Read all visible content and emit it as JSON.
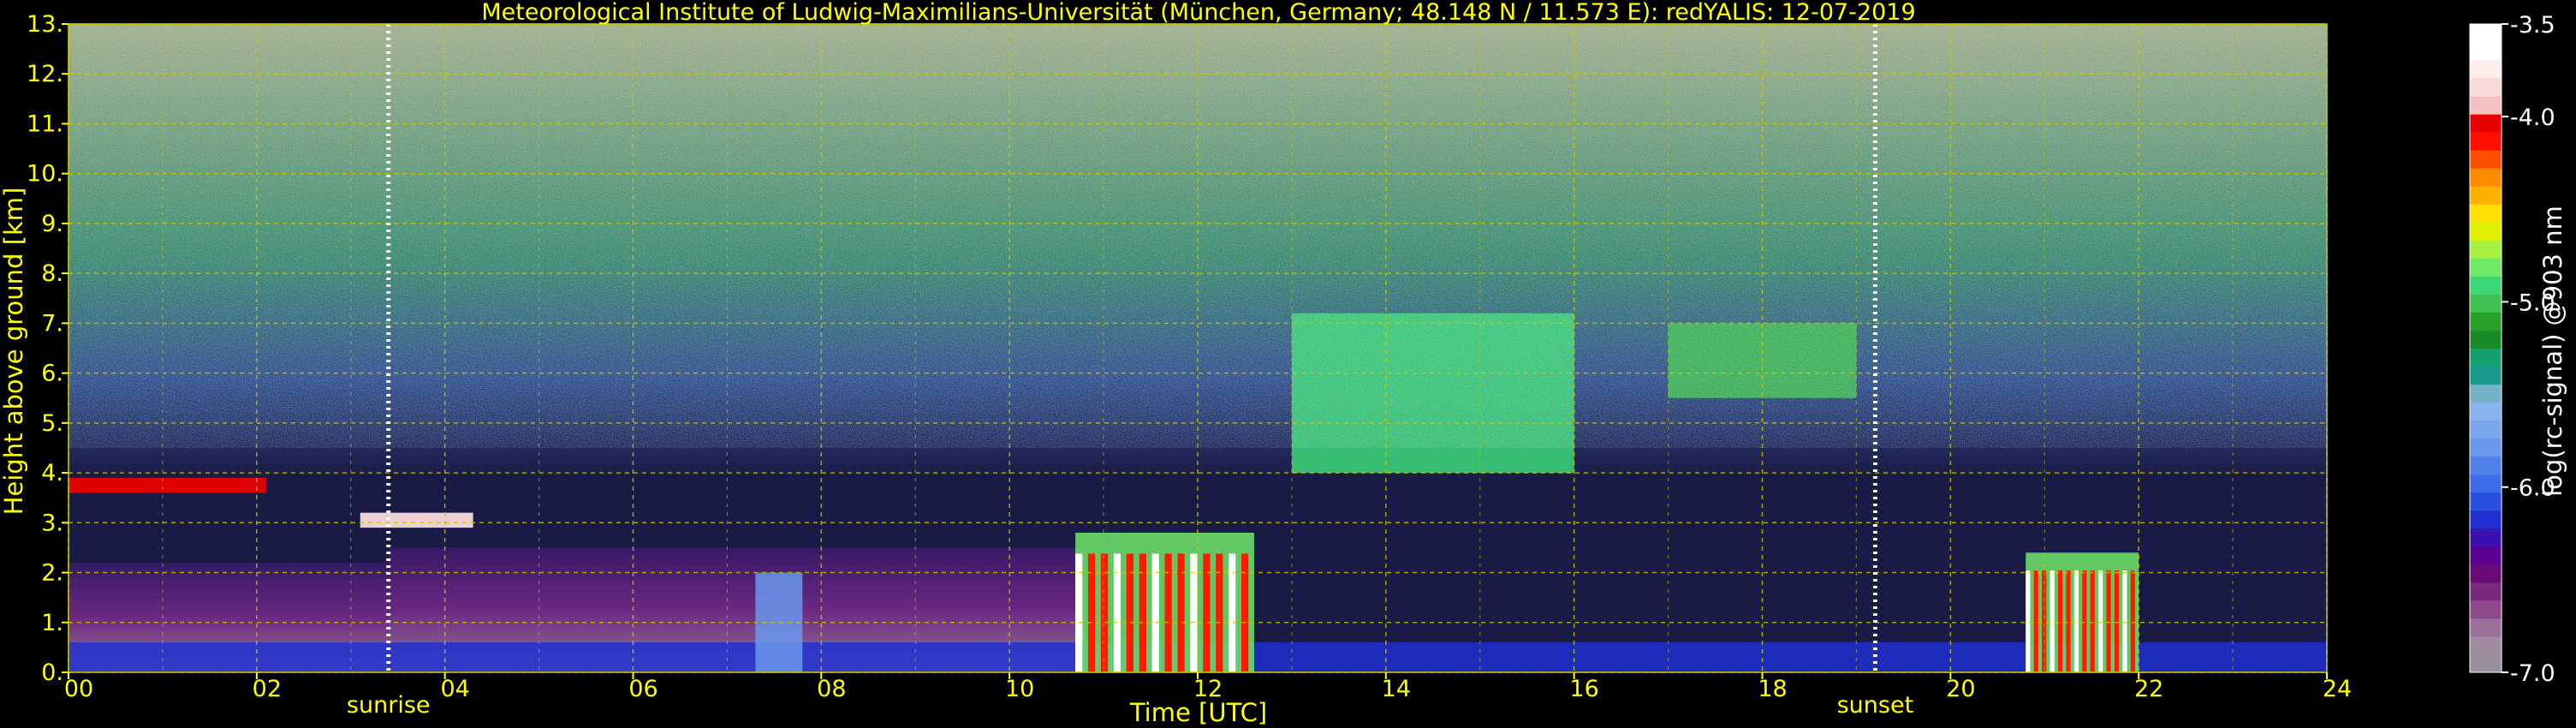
{
  "chart_data": {
    "type": "heatmap",
    "title": "Meteorological Institute of Ludwig-Maximilians-Universität (München, Germany; 48.148 N / 11.573 E):    redYALIS: 12-07-2019",
    "xlabel": "Time [UTC]",
    "ylabel": "Height above ground [km]",
    "xlim": [
      0,
      24
    ],
    "ylim": [
      0,
      13
    ],
    "x_ticks": [
      {
        "value": 0,
        "label": "00"
      },
      {
        "value": 2,
        "label": "02"
      },
      {
        "value": 4,
        "label": "04"
      },
      {
        "value": 6,
        "label": "06"
      },
      {
        "value": 8,
        "label": "08"
      },
      {
        "value": 10,
        "label": "10"
      },
      {
        "value": 12,
        "label": "12"
      },
      {
        "value": 14,
        "label": "14"
      },
      {
        "value": 16,
        "label": "16"
      },
      {
        "value": 18,
        "label": "18"
      },
      {
        "value": 20,
        "label": "20"
      },
      {
        "value": 22,
        "label": "22"
      },
      {
        "value": 24,
        "label": "24"
      }
    ],
    "y_ticks": [
      {
        "value": 0,
        "label": "0."
      },
      {
        "value": 1,
        "label": "1."
      },
      {
        "value": 2,
        "label": "2."
      },
      {
        "value": 3,
        "label": "3."
      },
      {
        "value": 4,
        "label": "4."
      },
      {
        "value": 5,
        "label": "5."
      },
      {
        "value": 6,
        "label": "6."
      },
      {
        "value": 7,
        "label": "7."
      },
      {
        "value": 8,
        "label": "8."
      },
      {
        "value": 9,
        "label": "9."
      },
      {
        "value": 10,
        "label": "10."
      },
      {
        "value": 11,
        "label": "11."
      },
      {
        "value": 12,
        "label": "12."
      },
      {
        "value": 13,
        "label": "13."
      }
    ],
    "grid": true,
    "grid_color": "#c8c800",
    "background_color": "#000000",
    "markers": [
      {
        "time": 3.4,
        "label": "sunrise"
      },
      {
        "time": 19.2,
        "label": "sunset"
      }
    ],
    "colorbar": {
      "label": "log(rc-signal) @903 nm",
      "range": [
        -7.0,
        -3.5
      ],
      "ticks": [
        {
          "value": -3.5,
          "label": "-3.5"
        },
        {
          "value": -4.0,
          "label": "-4.0"
        },
        {
          "value": -5.0,
          "label": "-5.0"
        },
        {
          "value": -6.0,
          "label": "-6.0"
        },
        {
          "value": -7.0,
          "label": "-7.0"
        }
      ],
      "colors_bottom_to_top": [
        "#9a8fa0",
        "#a08aa0",
        "#9a6f98",
        "#8c4a8a",
        "#7a2a7c",
        "#6a0a78",
        "#5a0090",
        "#3a10b0",
        "#2030d0",
        "#2a50e0",
        "#3c6ce8",
        "#5080ea",
        "#6a98ec",
        "#7aa8ee",
        "#88b4ee",
        "#74b0c8",
        "#1a9a8a",
        "#14a070",
        "#1a8a28",
        "#28a028",
        "#40c050",
        "#3cd878",
        "#70e868",
        "#a8f040",
        "#e0f000",
        "#ffe000",
        "#ffb000",
        "#ff8a00",
        "#ff5000",
        "#ff1000",
        "#e80000",
        "#f4c0c0",
        "#f8dada",
        "#fcecec",
        "#ffffff",
        "#ffffff"
      ]
    },
    "layers": [
      {
        "name": "noise-upper",
        "t0": 0,
        "t1": 24,
        "h0": 4.5,
        "h1": 13,
        "value": -5.4
      },
      {
        "name": "boundary-layer-0",
        "t0": 0,
        "t1": 3.4,
        "h0": 0,
        "h1": 2.2,
        "value": -6.5
      },
      {
        "name": "boundary-layer-1",
        "t0": 3.4,
        "t1": 10.8,
        "h0": 0,
        "h1": 2.5,
        "value": -6.6
      },
      {
        "name": "near-ground",
        "t0": 0,
        "t1": 24,
        "h0": 0,
        "h1": 0.6,
        "value": -6.2
      },
      {
        "name": "cloud-base-0",
        "t0": 0,
        "t1": 2.1,
        "h0": 3.6,
        "h1": 3.9,
        "value": -4.0
      },
      {
        "name": "cloud-base-1",
        "t0": 3.1,
        "t1": 4.3,
        "h0": 2.9,
        "h1": 3.2,
        "value": -3.8
      },
      {
        "name": "convective-cloud-12",
        "t0": 10.7,
        "t1": 12.6,
        "h0": 0,
        "h1": 2.8,
        "value": -4.8
      },
      {
        "name": "convective-cloud-21",
        "t0": 20.8,
        "t1": 22.0,
        "h0": 0,
        "h1": 2.4,
        "value": -4.8
      },
      {
        "name": "midlevel-clouds-14",
        "t0": 13.0,
        "t1": 16.0,
        "h0": 4.0,
        "h1": 7.2,
        "value": -4.9
      },
      {
        "name": "midlevel-clouds-18",
        "t0": 17.0,
        "t1": 19.0,
        "h0": 5.5,
        "h1": 7.0,
        "value": -5.0
      },
      {
        "name": "virga-07",
        "t0": 7.3,
        "t1": 7.8,
        "h0": 0,
        "h1": 2.0,
        "value": -5.8
      }
    ]
  }
}
